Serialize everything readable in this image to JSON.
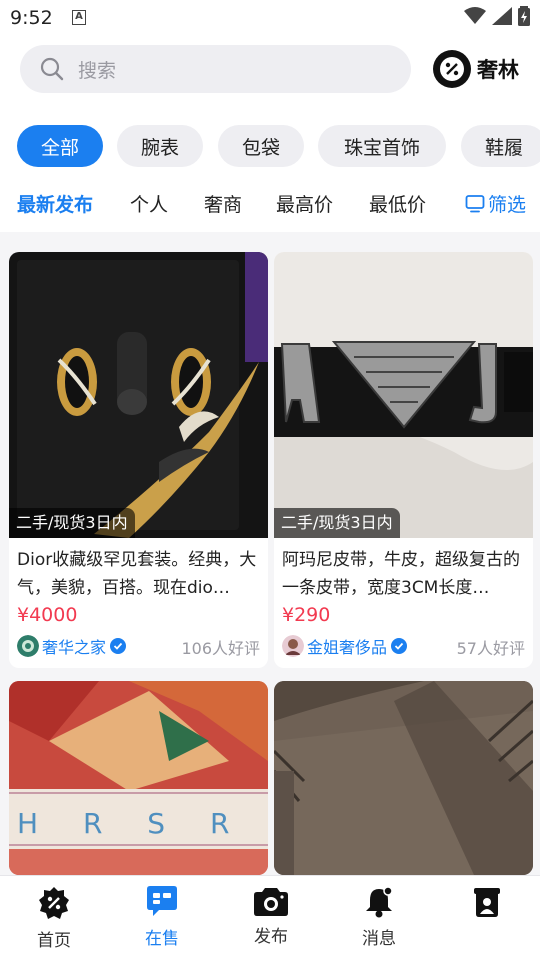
{
  "status_bar": {
    "time": "9:52",
    "notification_glyph": "A"
  },
  "search": {
    "placeholder": "搜索"
  },
  "brand": {
    "name": "奢林"
  },
  "categories": [
    "全部",
    "腕表",
    "包袋",
    "珠宝首饰",
    "鞋履"
  ],
  "active_category": "全部",
  "sort_tabs": [
    "最新发布",
    "个人",
    "奢商",
    "最高价",
    "最低价"
  ],
  "active_sort": "最新发布",
  "filter_label": "筛选",
  "listings": [
    {
      "tag": "二手/现货3日内",
      "title": "Dior收藏级罕见套装。经典，大气，美貌，百搭。现在dio…",
      "price": "¥4000",
      "seller": "奢华之家",
      "reviews": "106人好评"
    },
    {
      "tag": "二手/现货3日内",
      "title": "阿玛尼皮带，牛皮，超级复古的一条皮带，宽度3CM长度…",
      "price": "¥290",
      "seller": "金姐奢侈品",
      "reviews": "57人好评"
    },
    {
      "image_text": "H R S R S"
    }
  ],
  "tabs": [
    "首页",
    "在售",
    "发布",
    "消息",
    ""
  ],
  "active_tab": "在售",
  "colors": {
    "accent": "#1b7ff0",
    "price": "#f23a50",
    "background": "#f5f5f7"
  }
}
